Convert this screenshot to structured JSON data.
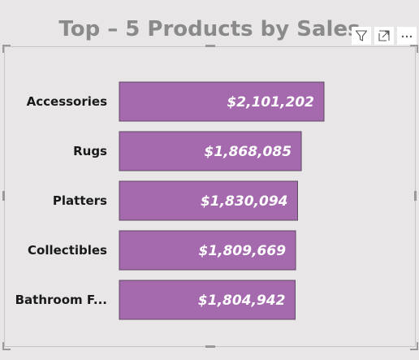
{
  "header": {
    "title": "Top – 5 Products by Sales"
  },
  "toolbar": {
    "icons": [
      "filter-icon",
      "focus-mode-icon",
      "more-options-icon"
    ]
  },
  "colors": {
    "bar_fill": "#a46aad",
    "bar_border": "#5e4a62",
    "background": "#e8e6e7"
  },
  "chart_data": {
    "type": "bar",
    "orientation": "horizontal",
    "title": "Top – 5 Products by Sales",
    "categories": [
      "Accessories",
      "Rugs",
      "Platters",
      "Collectibles",
      "Bathroom F..."
    ],
    "values": [
      2101202,
      1868085,
      1830094,
      1809669,
      1804942
    ],
    "value_labels": [
      "$2,101,202",
      "$1,868,085",
      "$1,830,094",
      "$1,809,669",
      "$1,804,942"
    ],
    "xlim": [
      0,
      2101202
    ],
    "grid": false,
    "legend": "none"
  }
}
